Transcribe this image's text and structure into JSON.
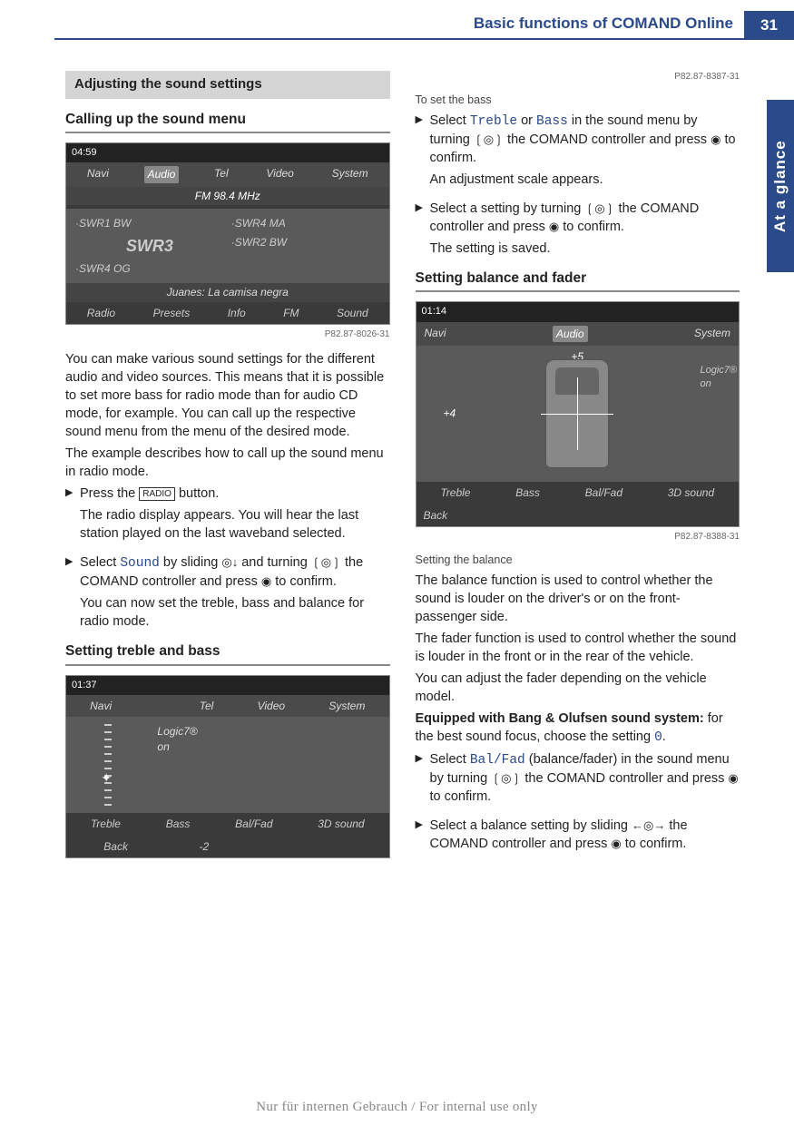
{
  "header": {
    "title": "Basic functions of COMAND Online",
    "page_number": "31"
  },
  "side_tab": "At a glance",
  "section_heading": "Adjusting the sound settings",
  "sub1": "Calling up the sound menu",
  "screenshot1": {
    "time": "04:59",
    "menu": [
      "Navi",
      "Audio",
      "Tel",
      "Video",
      "System"
    ],
    "menu_active": "Audio",
    "freq": "FM 98.4 MHz",
    "stations": [
      "·SWR1 BW",
      "·SWR4 MA",
      "SWR3",
      "·SWR2 BW",
      "·SWR4 OG"
    ],
    "track": "Juanes: La camisa negra",
    "bottom": [
      "Radio",
      "Presets",
      "Info",
      "FM",
      "Sound"
    ],
    "ref": "P82.87-8026-31"
  },
  "para1": "You can make various sound settings for the different audio and video sources. This means that it is possible to set more bass for radio mode than for audio CD mode, for example. You can call up the respective sound menu from the menu of the desired mode.",
  "para2": "The example describes how to call up the sound menu in radio mode.",
  "step1a": "Press the ",
  "step1_btn": "RADIO",
  "step1b": " button.",
  "step1_result": "The radio display appears. You will hear the last station played on the last waveband selected.",
  "step2a": "Select ",
  "step2_mono": "Sound",
  "step2b": " by sliding ",
  "step2c": " and turning ",
  "step2d": " the COMAND controller and press ",
  "step2e": " to confirm.",
  "step2_result": "You can now set the treble, bass and balance for radio mode.",
  "sub2": "Setting treble and bass",
  "screenshot2": {
    "time": "01:37",
    "menu": [
      "Navi",
      "",
      "Tel",
      "Video",
      "System"
    ],
    "right1": "Logic7®",
    "right2": "on",
    "bottom1": [
      "Treble",
      "Bass",
      "Bal/Fad",
      "3D sound"
    ],
    "bottom2": [
      "Back",
      "-2",
      "",
      ""
    ],
    "ref": "P82.87-8387-31"
  },
  "caption2": "To set the bass",
  "step3a": "Select ",
  "step3_mono1": "Treble",
  "step3_or": " or ",
  "step3_mono2": "Bass",
  "step3b": " in the sound menu by turning ",
  "step3c": " the COMAND controller and press ",
  "step3d": " to confirm.",
  "step3_result": "An adjustment scale appears.",
  "step4a": "Select a setting by turning ",
  "step4b": " the COMAND controller and press ",
  "step4c": " to confirm.",
  "step4_result": "The setting is saved.",
  "sub3": "Setting balance and fader",
  "screenshot3": {
    "time": "01:14",
    "menu_left": "Navi",
    "menu_audio": "Audio",
    "menu_right": "System",
    "top_val": "+5",
    "left_val": "+4",
    "right1": "Logic7®",
    "right2": "on",
    "bottom1": [
      "Treble",
      "Bass",
      "Bal/Fad",
      "3D sound"
    ],
    "bottom2": "Back",
    "balfad": "Bal/Fad",
    "ref": "P82.87-8388-31"
  },
  "caption3": "Setting the balance",
  "para3": "The balance function is used to control whether the sound is louder on the driver's or on the front-passenger side.",
  "para4": "The fader function is used to control whether the sound is louder in the front or in the rear of the vehicle.",
  "para5": "You can adjust the fader depending on the vehicle model.",
  "para6a": "Equipped with Bang & Olufsen sound system:",
  "para6b": " for the best sound focus, choose the setting ",
  "para6_mono": "0",
  "para6c": ".",
  "step5a": "Select ",
  "step5_mono": "Bal/Fad",
  "step5b": " (balance/fader) in the sound menu by turning ",
  "step5c": " the COMAND controller and press ",
  "step5d": " to confirm.",
  "step6a": "Select a balance setting by sliding ",
  "step6b": " the COMAND controller and press ",
  "step6c": " to confirm.",
  "footer": "Nur für internen Gebrauch / For internal use only"
}
